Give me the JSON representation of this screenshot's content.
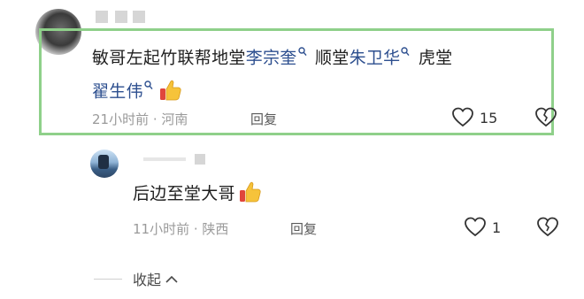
{
  "comment": {
    "text_parts": [
      {
        "text": "敏哥左起竹联帮地堂",
        "link": false
      },
      {
        "text": "李宗奎",
        "link": true
      },
      {
        "text": "顺堂",
        "link": false
      },
      {
        "text": "朱卫华",
        "link": true
      },
      {
        "text": "虎堂",
        "link": false
      },
      {
        "text": "翟生伟",
        "link": true
      }
    ],
    "time": "21小时前",
    "location": "河南",
    "reply_label": "回复",
    "like_count": "15"
  },
  "reply": {
    "text": "后边至堂大哥",
    "time": "11小时前",
    "location": "陕西",
    "reply_label": "回复",
    "like_count": "1"
  },
  "collapse_label": "收起",
  "colors": {
    "highlight_frame": "#8fd08a",
    "link_text": "#2d4f8f",
    "meta_text": "#9a9a9a"
  },
  "icons": [
    "thumbs-up-emoji",
    "heart-icon",
    "broken-heart-icon",
    "search-icon",
    "chevron-up-icon"
  ]
}
